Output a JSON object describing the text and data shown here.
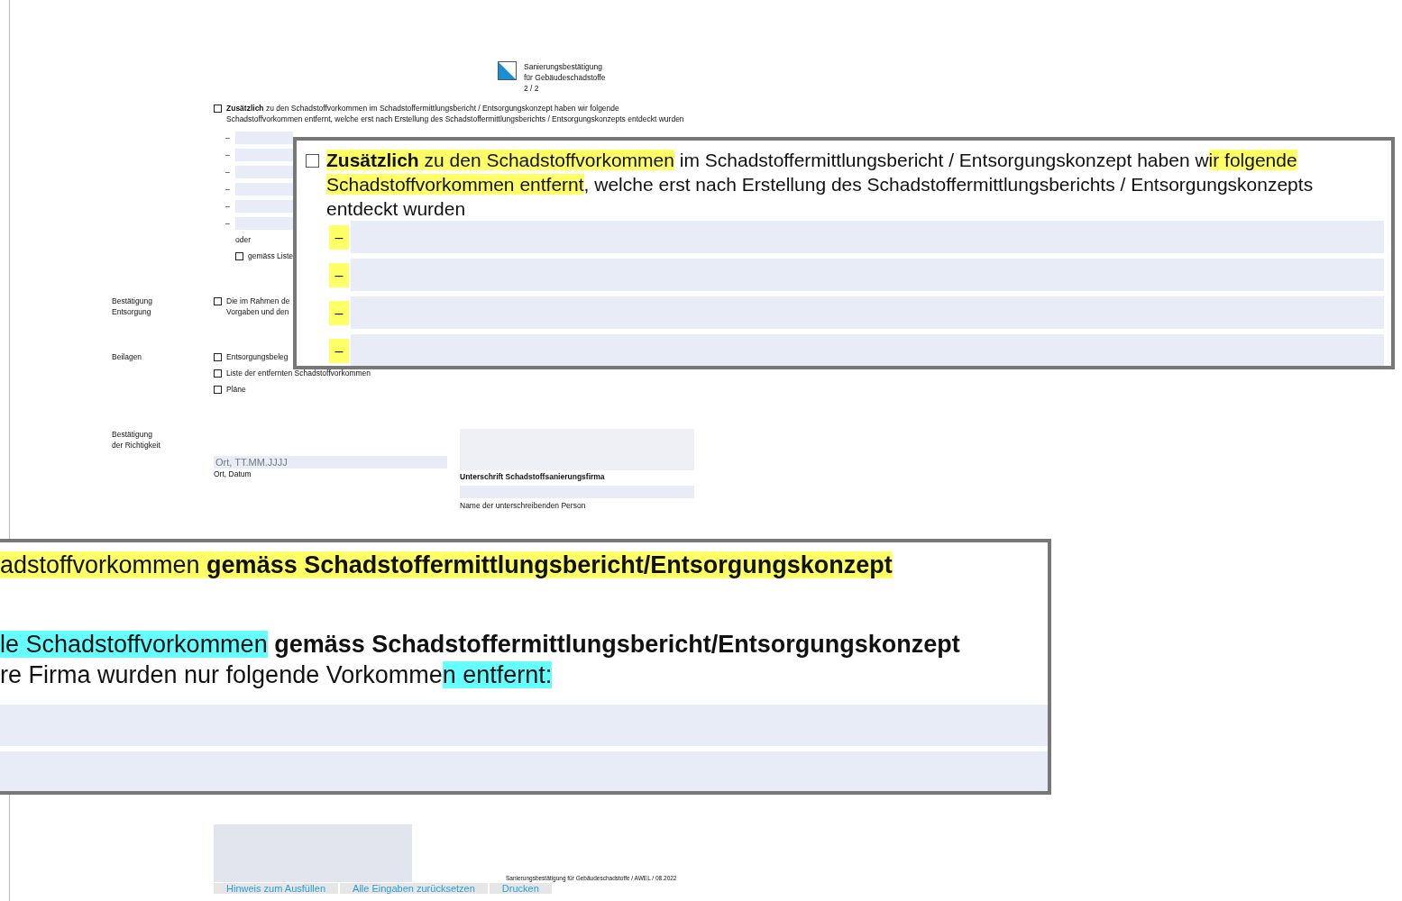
{
  "header": {
    "lines": [
      "Sanierungsbestätigung",
      "für Gebäudeschadstoffe",
      "2 / 2"
    ]
  },
  "additional": {
    "checked": false,
    "text": "**Zusätzlich** zu den Schadstoffvorkommen im Schadstoffermittlungsbericht / Entsorgungskonzept haben wir folgende Schadstoffvorkommen entfernt, welche erst nach Erstellung des Schadstoffermittlungsberichts / Entsorgungskonzepts entdeckt wurden",
    "dashes": [
      "–",
      "–",
      "–",
      "–",
      "–",
      "–"
    ],
    "or_label": "oder",
    "list_option": {
      "checked": false,
      "label": "gemäss Liste"
    }
  },
  "sections": [
    {
      "label": "Bestätigung Entsorgung",
      "options": [
        {
          "checked": false,
          "label": "Die im Rahmen de\nVorgaben und den"
        }
      ]
    },
    {
      "label": "Beilagen",
      "options": [
        {
          "checked": false,
          "label": "Entsorgungsbeleg"
        },
        {
          "checked": false,
          "label": "Liste der entfernten Schadstoffvorkommen"
        },
        {
          "checked": false,
          "label": "Pläne"
        }
      ]
    }
  ],
  "signature": {
    "label": "Bestätigung\nder Richtigkeit",
    "date_placeholder": "Ort, TT.MM.JJJJ",
    "date_caption": "Ort, Datum",
    "signer_title": "Unterschrift Schadstoffsanierungsfirma",
    "name_caption": "Name der unterschreibenden Person"
  },
  "footer": {
    "text": "Sanierungsbestätigung für Gebäudeschadstoffe / AWEL / 08.2022",
    "buttons": [
      "Hinweis zum Ausfüllen",
      "Alle Eingaben zurücksetzen",
      "Drucken"
    ]
  },
  "callout_top": {
    "checked": false,
    "segments": [
      {
        "text": "Zusätzlich",
        "bold": true,
        "color": "#ffff66"
      },
      {
        "text": " zu den Schadstoffvorkommen",
        "bold": false,
        "color": "#ffff66"
      },
      {
        "text": " im Schadstoffermittlungsbericht / Entsorgungskonzept haben w",
        "bold": false
      },
      {
        "text": "ir folgende ",
        "bold": false,
        "color": "#ffff66"
      },
      {
        "text": "Schadstoffvorkommen entfernt",
        "bold": false,
        "color": "#ffff66"
      },
      {
        "text": ", welche erst nach Erstellung des Schadstoffermittlungsberichts / Entsorgungskonzepts entdeckt wurden",
        "bold": false
      }
    ],
    "dashes": [
      "–",
      "–",
      "–",
      "–"
    ]
  },
  "callout_bottom": {
    "lines": [
      [
        {
          "text": "adstoffvorkommen ",
          "bold": false,
          "color": "#ffff66"
        },
        {
          "text": "gemäss Schadstoffermittlungsbericht/Entsorgungskonzept",
          "bold": true,
          "color": "#ffff66"
        }
      ],
      [
        {
          "text": "le Schadstoffvorkommen",
          "bold": false,
          "color": "#66ffff"
        },
        {
          "text": " gemäss Schadstoffermittlungsbericht/Entsorgungskonzept",
          "bold": true
        }
      ],
      [
        {
          "text": "re Firma wurden nur folgende Vorkomme",
          "bold": false
        },
        {
          "text": "n entfernt:",
          "bold": false,
          "color": "#66ffff"
        }
      ]
    ]
  }
}
